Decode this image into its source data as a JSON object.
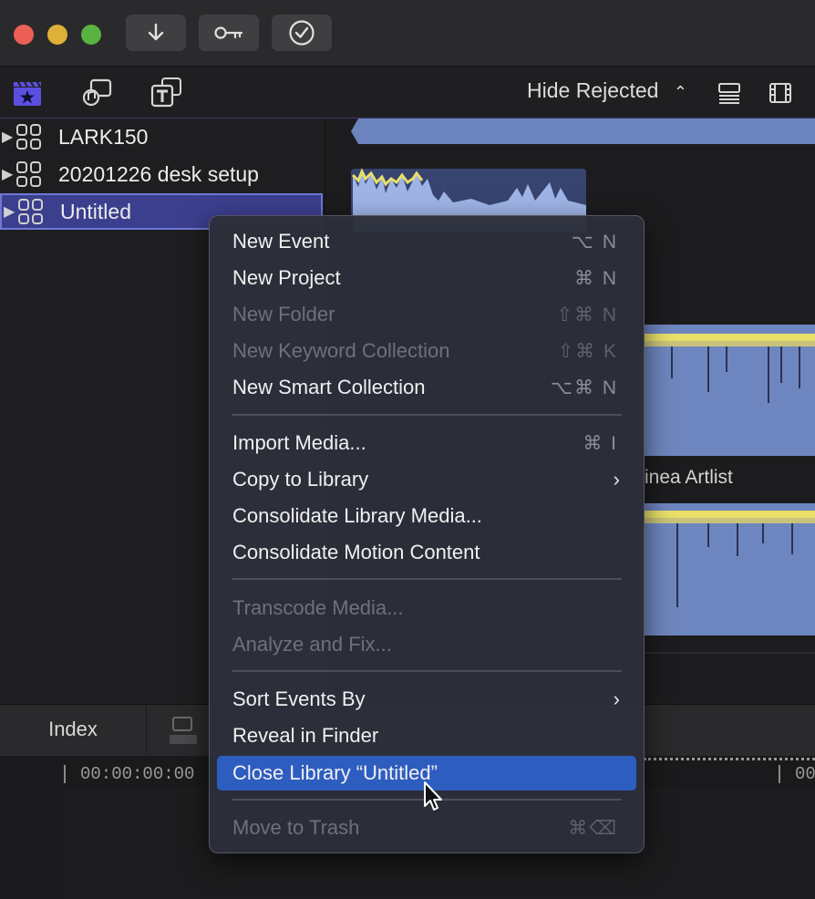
{
  "colors": {
    "close": "#ec5f57",
    "minimize": "#dfb038",
    "zoom": "#59b342",
    "selection": "#3b3f8e",
    "menu_highlight": "#2e5dc0",
    "waveform_blue": "#6e86bf",
    "waveform_yellow": "#e9df6a"
  },
  "toolbar": {
    "icons": [
      "download-icon",
      "key-icon",
      "checkmark-circle-icon"
    ]
  },
  "browser_toolbar": {
    "icons": [
      "libraries-clapper-icon",
      "photos-audio-icon",
      "titles-generators-icon",
      "list-view-icon",
      "filmstrip-icon"
    ],
    "filter_label": "Hide Rejected",
    "filter_chevron": "⌃⌄"
  },
  "sidebar": {
    "libraries": [
      {
        "name": "LARK150",
        "selected": false
      },
      {
        "name": "20201226 desk setup",
        "selected": false
      },
      {
        "name": "Untitled",
        "selected": true
      }
    ]
  },
  "browser": {
    "clip_label": "inea Artlist"
  },
  "timeline": {
    "index_label": "Index",
    "timecode_start": "00:00:00:00",
    "timecode_end": "00"
  },
  "menu": {
    "items": [
      {
        "label": "New Event",
        "shortcut": "⌥ N",
        "disabled": false
      },
      {
        "label": "New Project",
        "shortcut": "⌘ N",
        "disabled": false
      },
      {
        "label": "New Folder",
        "shortcut": "⇧⌘ N",
        "disabled": true
      },
      {
        "label": "New Keyword Collection",
        "shortcut": "⇧⌘ K",
        "disabled": true
      },
      {
        "label": "New Smart Collection",
        "shortcut": "⌥⌘ N",
        "disabled": false
      },
      {
        "label": "Import Media...",
        "shortcut": "⌘ I",
        "disabled": false
      },
      {
        "label": "Copy to Library",
        "submenu": "›",
        "disabled": false
      },
      {
        "label": "Consolidate Library Media...",
        "disabled": false
      },
      {
        "label": "Consolidate Motion Content",
        "disabled": false
      },
      {
        "label": "Transcode Media...",
        "disabled": true
      },
      {
        "label": "Analyze and Fix...",
        "disabled": true
      },
      {
        "label": "Sort Events By",
        "submenu": "›",
        "disabled": false
      },
      {
        "label": "Reveal in Finder",
        "disabled": false
      },
      {
        "label": "Close Library “Untitled”",
        "disabled": false,
        "highlighted": true
      },
      {
        "label": "Move to Trash",
        "shortcut": "⌘⌫",
        "disabled": true
      }
    ]
  }
}
